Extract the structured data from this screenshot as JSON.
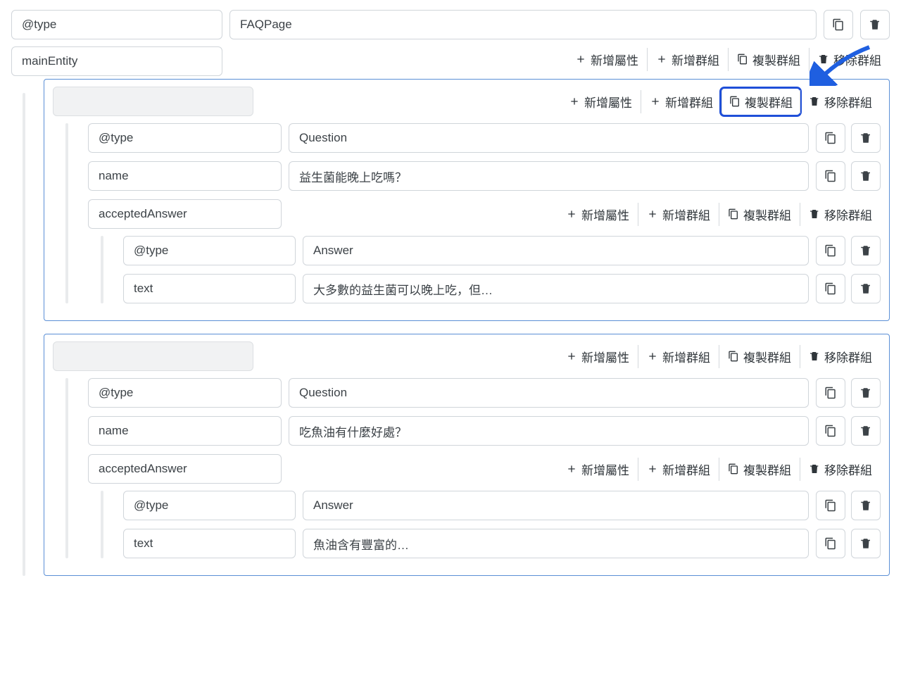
{
  "root": {
    "type_key": "@type",
    "type_value": "FAQPage",
    "main_entity_key": "mainEntity"
  },
  "toolbar": {
    "add_prop": "新增屬性",
    "add_group": "新增群組",
    "copy_group": "複製群組",
    "remove_group": "移除群組"
  },
  "questions": [
    {
      "type_key": "@type",
      "type_value": "Question",
      "name_key": "name",
      "name_value": "益生菌能晚上吃嗎？",
      "accepted_key": "acceptedAnswer",
      "answer": {
        "type_key": "@type",
        "type_value": "Answer",
        "text_key": "text",
        "text_value": "大多數的益生菌可以晚上吃，但…"
      }
    },
    {
      "type_key": "@type",
      "type_value": "Question",
      "name_key": "name",
      "name_value": "吃魚油有什麼好處？",
      "accepted_key": "acceptedAnswer",
      "answer": {
        "type_key": "@type",
        "type_value": "Answer",
        "text_key": "text",
        "text_value": "魚油含有豐富的…"
      }
    }
  ]
}
